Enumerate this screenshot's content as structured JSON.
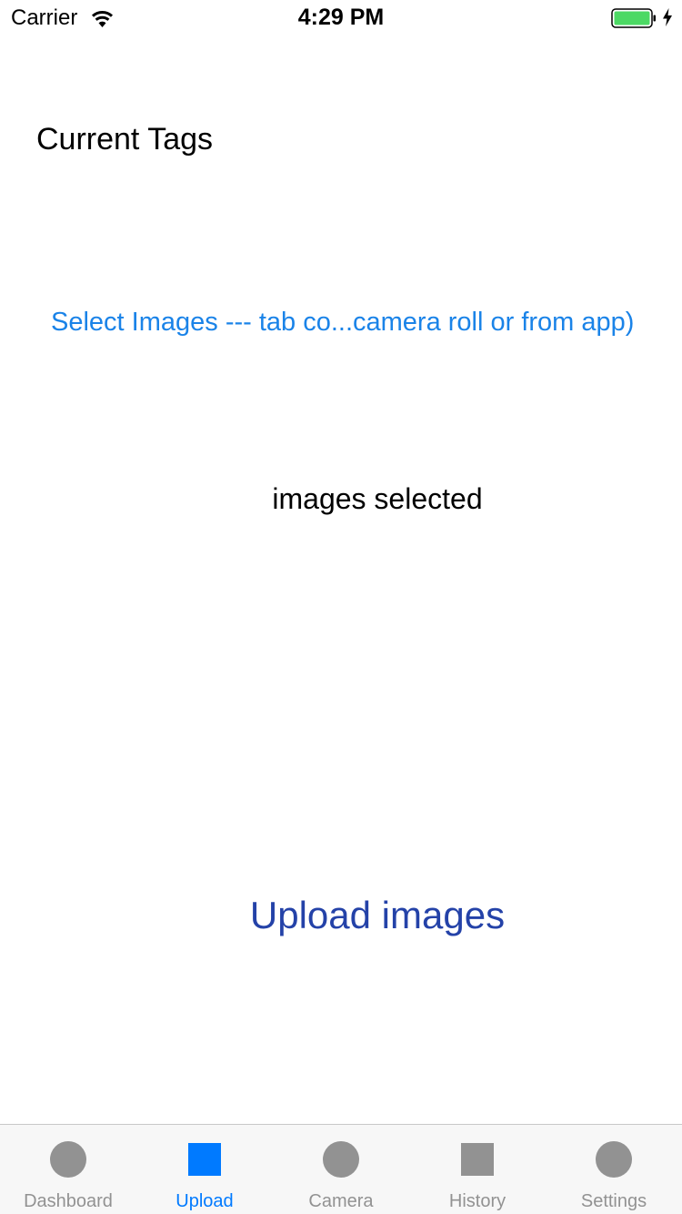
{
  "status_bar": {
    "carrier": "Carrier",
    "time": "4:29 PM",
    "wifi_icon": "wifi-icon",
    "battery_icon": "battery-icon",
    "battery_color": "#4cd964"
  },
  "main": {
    "current_tags_label": "Current Tags",
    "select_images_button": "Select Images --- tab co...camera roll or from app)",
    "images_selected_label": "images selected",
    "upload_button": "Upload images"
  },
  "colors": {
    "link_blue": "#1a83e8",
    "upload_blue": "#2442a8",
    "tab_active": "#007aff",
    "tab_inactive": "#929292"
  },
  "tab_bar": {
    "tabs": [
      {
        "label": "Dashboard",
        "icon": "circle-icon",
        "active": false
      },
      {
        "label": "Upload",
        "icon": "square-icon",
        "active": true
      },
      {
        "label": "Camera",
        "icon": "circle-icon",
        "active": false
      },
      {
        "label": "History",
        "icon": "square-icon",
        "active": false
      },
      {
        "label": "Settings",
        "icon": "circle-icon",
        "active": false
      }
    ]
  }
}
